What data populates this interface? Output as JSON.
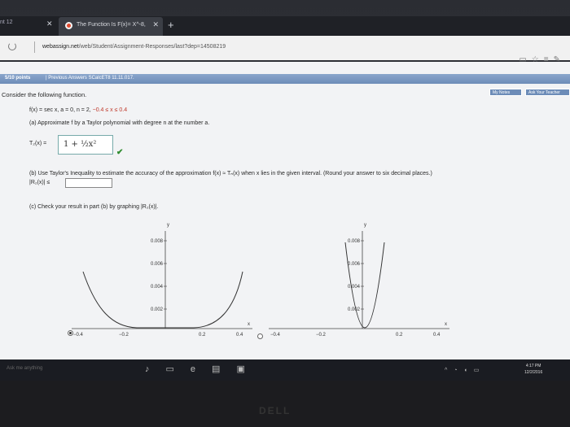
{
  "browser": {
    "prev_tab_label": "nt 12",
    "active_tab_title": "The Function Is F(x)= X^-8,",
    "url_domain": "webassign.net",
    "url_path": "/web/Student/Assignment-Responses/last?dep=14508219"
  },
  "header": {
    "points": "5/10 points",
    "prev_answers": "| Previous Answers  SCalcET8 11.11.017.",
    "my_notes": "My Notes",
    "ask_teacher": "Ask Your Teacher"
  },
  "question": {
    "intro": "Consider the following function.",
    "func_line": "f(x) = sec x,   a = 0,   n = 2,   ",
    "interval": "−0.4 ≤ x ≤ 0.4",
    "part_a": "(a) Approximate f by a Taylor polynomial with degree n at the number a.",
    "t2_label": "T₂(x) =",
    "t2_answer": "1 + ½x²",
    "part_b": "(b) Use Taylor's Inequality to estimate the accuracy of the approximation  f(x) ≈ Tₙ(x)  when x lies in the given interval. (Round your answer to six decimal places.)",
    "r2_label": "|R₂(x)| ≤",
    "r2_value": "",
    "part_c": "(c) Check your result in part (b) by graphing  |R₂(x)|."
  },
  "graph_left": {
    "ylabel": "y",
    "xlabel": "x",
    "yticks": [
      "0.008",
      "0.006",
      "0.004",
      "0.002"
    ],
    "xticks": [
      "−0.4",
      "−0.2",
      "0.2",
      "0.4"
    ]
  },
  "graph_right": {
    "ylabel": "y",
    "xlabel": "x",
    "yticks": [
      "0.008",
      "0.006",
      "0.004",
      "0.002"
    ],
    "xticks": [
      "−0.4",
      "−0.2",
      "0.2",
      "0.4"
    ]
  },
  "taskbar": {
    "search": "Ask me anything",
    "time": "4:17 PM",
    "date": "12/2/2016"
  },
  "bezel_brand": "DELL",
  "colors": {
    "header": "#6d8cb8",
    "check": "#2e8b2e",
    "interval": "#c0392b"
  }
}
